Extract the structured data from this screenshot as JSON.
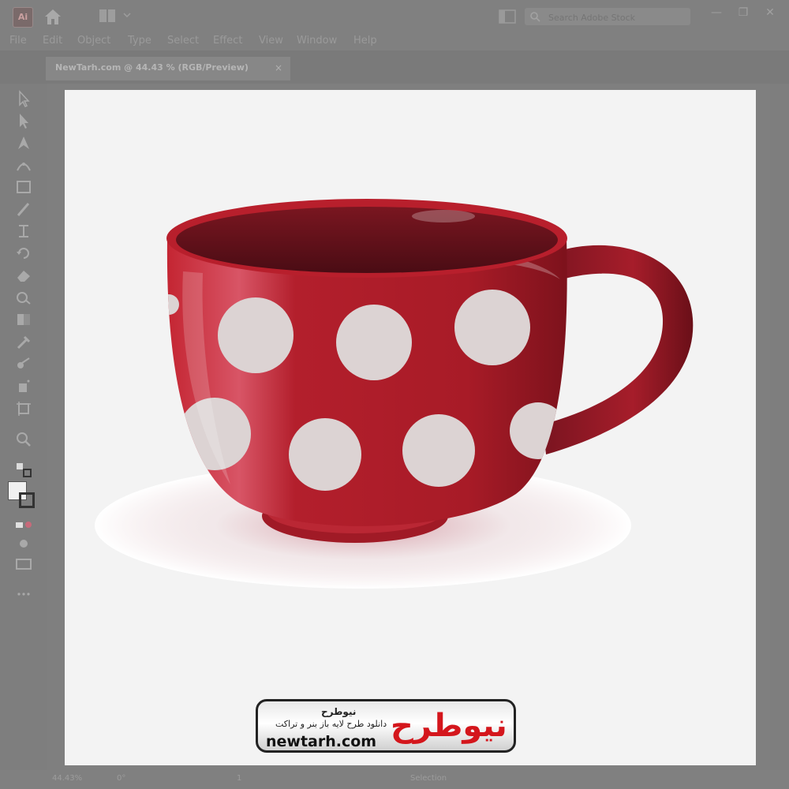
{
  "app": {
    "logo_text": "Ai"
  },
  "search": {
    "placeholder": "Search Adobe Stock"
  },
  "window_controls": {
    "minimize": "—",
    "maximize": "❐",
    "close": "✕"
  },
  "menu": [
    "File",
    "Edit",
    "Object",
    "Type",
    "Select",
    "Effect",
    "View",
    "Window",
    "Help"
  ],
  "document_tab": {
    "label": "NewTarh.com @ 44.43 % (RGB/Preview)",
    "close": "×"
  },
  "status": {
    "zoom": "44.43%",
    "rotation": "0°",
    "artboard_nav": "1",
    "mode": "Selection"
  },
  "watermark": {
    "title": "نیوطرح",
    "subtitle": "دانلود طرح لایه باز بنر و تراکت",
    "brand": "newtarh.com",
    "logo": "نیوطرح"
  },
  "tools": [
    "selection-tool-icon",
    "direct-selection-tool-icon",
    "pen-tool-icon",
    "curvature-tool-icon",
    "rectangle-tool-icon",
    "paintbrush-tool-icon",
    "width-tool-icon",
    "rotate-tool-icon",
    "eraser-tool-icon",
    "shape-builder-tool-icon",
    "gradient-tool-icon",
    "eyedropper-tool-icon",
    "blend-tool-icon",
    "symbol-sprayer-tool-icon",
    "artboard-tool-icon",
    "zoom-tool-icon"
  ],
  "colors": {
    "cup_red": "#b01f2a",
    "cup_dark": "#5e1018",
    "dots": "#dcd3d3",
    "artboard": "#f3f3f3",
    "chrome": "#808080",
    "logo_red": "#d4161c"
  }
}
